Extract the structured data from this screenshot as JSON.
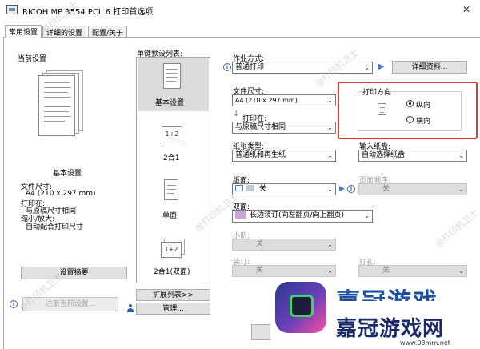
{
  "window": {
    "title": "RICOH MP 3554 PCL 6 打印首选项",
    "close_glyph": "✕"
  },
  "tabs": [
    {
      "label": "常用设置",
      "active": true
    },
    {
      "label": "详细的设置",
      "active": false
    },
    {
      "label": "配置/关于",
      "active": false
    }
  ],
  "current_settings": {
    "heading": "当前设置",
    "name": "基本设置",
    "details": [
      "文件尺寸:",
      "A4 (210 x 297 mm)",
      "打印在:",
      "与原稿尺寸相同",
      "缩小/放大:",
      "自动配合打印尺寸"
    ],
    "summary_button": "设置摘要",
    "register_button": "注册当前设置..."
  },
  "presets": {
    "heading": "单键预设列表:",
    "items": [
      {
        "label": "基本设置",
        "selected": true
      },
      {
        "label": "2合1",
        "selected": false,
        "icon_text": "1+2"
      },
      {
        "label": "单面",
        "selected": false
      },
      {
        "label": "2合1(双面)",
        "selected": false,
        "icon_text": "1+2"
      }
    ],
    "expand_button": "扩展列表>>",
    "manage_button": "管理..."
  },
  "job": {
    "label": "作业方式:",
    "value": "普通打印",
    "details_button": "详细资料..."
  },
  "paper_size": {
    "label": "文件尺寸:",
    "value": "A4 (210 x 297 mm)"
  },
  "print_on": {
    "label": "打印在:",
    "value": "与原稿尺寸相同"
  },
  "orientation": {
    "label": "打印方向",
    "options": [
      {
        "label": "纵向",
        "selected": true
      },
      {
        "label": "横向",
        "selected": false
      }
    ]
  },
  "paper_type": {
    "label": "纸张类型:",
    "value": "普通纸和再生纸"
  },
  "input_tray": {
    "label": "输入纸盘:",
    "value": "自动选择纸盘"
  },
  "layout": {
    "label": "版面:",
    "value": "关"
  },
  "page_order": {
    "label": "页面顺序:",
    "value": "关"
  },
  "duplex": {
    "label": "双面:",
    "value": "长边装订(向左翻页/向上翻页)"
  },
  "booklet": {
    "label": "小册:",
    "value": "关"
  },
  "staple": {
    "label": "装订:",
    "value": "关"
  },
  "punch": {
    "label": "打孔:",
    "value": "关"
  },
  "watermark_text": "@打印机卫士",
  "ad": {
    "title": "嘉冠游戏",
    "chars": "嘉冠游戏网",
    "url": "www.03mm.net"
  }
}
